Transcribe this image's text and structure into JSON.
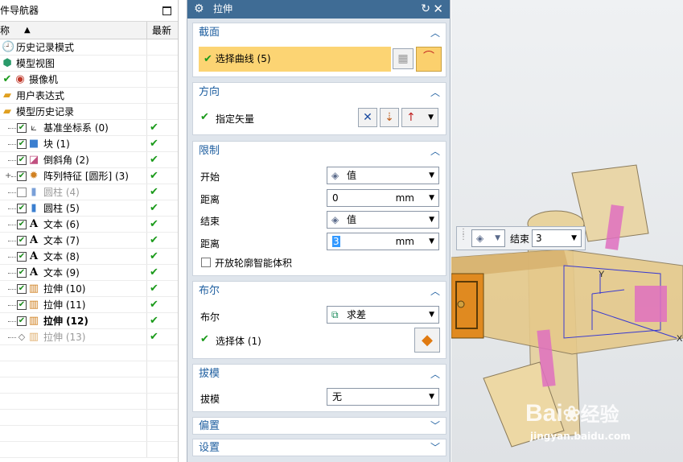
{
  "nav": {
    "title": "件导航器",
    "col_name": "称",
    "col_latest": "最新",
    "sort_glyph": "▲",
    "items": [
      {
        "label": "历史记录模式",
        "icon": "clock"
      },
      {
        "label": "模型视图",
        "icon": "cube-views"
      },
      {
        "label": "摄像机",
        "icon": "camera"
      },
      {
        "label": "用户表达式",
        "icon": "folder"
      },
      {
        "label": "模型历史记录",
        "icon": "folder-open"
      },
      {
        "label": "基准坐标系 (0)",
        "latest": "✔"
      },
      {
        "label": "块 (1)",
        "latest": "✔"
      },
      {
        "label": "倒斜角 (2)",
        "latest": "✔"
      },
      {
        "label": "阵列特征 [圆形] (3)",
        "latest": "✔"
      },
      {
        "label": "圆柱 (4)",
        "latest": "✔"
      },
      {
        "label": "圆柱 (5)",
        "latest": "✔"
      },
      {
        "label": "文本 (6)",
        "latest": "✔"
      },
      {
        "label": "文本 (7)",
        "latest": "✔"
      },
      {
        "label": "文本 (8)",
        "latest": "✔"
      },
      {
        "label": "文本 (9)",
        "latest": "✔"
      },
      {
        "label": "拉伸 (10)",
        "latest": "✔"
      },
      {
        "label": "拉伸 (11)",
        "latest": "✔"
      },
      {
        "label": "拉伸 (12)",
        "latest": "✔"
      },
      {
        "label": "拉伸 (13)",
        "latest": "✔"
      }
    ]
  },
  "dialog": {
    "title": "拉伸",
    "section": {
      "label": "截面",
      "select_curve": "选择曲线 (5)"
    },
    "direction": {
      "label": "方向",
      "vector": "指定矢量"
    },
    "limits": {
      "label": "限制",
      "start_label": "开始",
      "start_value": "值",
      "start_dist_label": "距离",
      "start_dist_value": "0",
      "unit": "mm",
      "end_label": "结束",
      "end_value": "值",
      "end_dist_label": "距离",
      "end_dist_value": "3",
      "open_profile": "开放轮廓智能体积"
    },
    "boolean": {
      "label": "布尔",
      "field_label": "布尔",
      "value": "求差",
      "select_body": "选择体 (1)"
    },
    "draft": {
      "label": "拔模",
      "field_label": "拔模",
      "value": "无"
    },
    "offset": {
      "label": "偏置"
    },
    "settings": {
      "label": "设置"
    }
  },
  "viewport": {
    "end_label": "结束",
    "end_value": "3",
    "axis_x": "X",
    "axis_y": "Y",
    "watermark_main": "Bai",
    "watermark_du": "du",
    "watermark_jingyan": "经验",
    "watermark_url": "jingyan.baidu.com"
  },
  "colors": {
    "accent_blue": "#3f6c95",
    "header_blue": "#1f5fa0",
    "check_green": "#1a9a1a",
    "highlight_yellow": "#fcd473"
  }
}
